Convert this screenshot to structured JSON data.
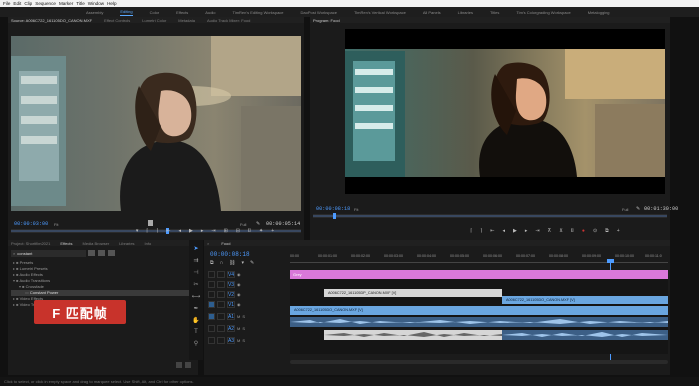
{
  "menu": [
    "File",
    "Edit",
    "Clip",
    "Sequence",
    "Marker",
    "Title",
    "Window",
    "Help"
  ],
  "workspaces": [
    {
      "label": "Assembly",
      "active": false
    },
    {
      "label": "Editing",
      "active": true
    },
    {
      "label": "Color",
      "active": false
    },
    {
      "label": "Effects",
      "active": false
    },
    {
      "label": "Audio",
      "active": false
    },
    {
      "label": "TimRen's Editing Workspace",
      "active": false
    },
    {
      "label": "DaoPost Workspace",
      "active": false
    },
    {
      "label": "TimRen's Vertical Workspace",
      "active": false
    },
    {
      "label": "All Panels",
      "active": false
    },
    {
      "label": "Libraries",
      "active": false
    },
    {
      "label": "Titles",
      "active": false
    },
    {
      "label": "Tim's Colorgrading Workspace",
      "active": false
    },
    {
      "label": "Metalogging",
      "active": false
    }
  ],
  "source": {
    "tabs": [
      "Source: A006C722_161105DO_CANON.MXF",
      "Effect Controls",
      "Lumetri Color",
      "Metadata",
      "Audio Track Mixer: Food"
    ],
    "timecode": "00:00:03:00",
    "fit": "Fit",
    "quality": "Full",
    "duration": "00:00:05:14"
  },
  "program": {
    "tab": "Program: Food",
    "timecode": "00:00:08:18",
    "fit": "Fit",
    "quality": "Full",
    "duration": "00:01:30:00"
  },
  "effects": {
    "tabs": [
      "Project: Shortfilm2021",
      "Effects",
      "Media Browser",
      "Libraries",
      "Info"
    ],
    "search_value": "constant",
    "tree": [
      {
        "label": "Presets",
        "level": 0
      },
      {
        "label": "Lumetri Presets",
        "level": 0
      },
      {
        "label": "Audio Effects",
        "level": 0
      },
      {
        "label": "Audio Transitions",
        "level": 0
      },
      {
        "label": "Crossfade",
        "level": 1
      },
      {
        "label": "Constant Power",
        "level": 2
      },
      {
        "label": "Video Effects",
        "level": 0
      },
      {
        "label": "Video Transitions",
        "level": 0
      }
    ]
  },
  "timeline": {
    "tab": "Food",
    "timecode": "00:00:08:18",
    "ruler": [
      "00:00",
      "00:00:01:00",
      "00:00:02:00",
      "00:00:03:00",
      "00:00:04:00",
      "00:00:05:00",
      "00:00:06:00",
      "00:00:07:00",
      "00:00:08:00",
      "00:00:09:00",
      "00:00:10:00",
      "00:00:11:0"
    ],
    "tracks": [
      "V4",
      "V3",
      "V2",
      "V1",
      "A1",
      "A2",
      "A3"
    ],
    "clips": {
      "adjustment": "Grey",
      "v3a": "A006C722_161105DP_CANON.MXF [V]",
      "v3b": "A006C722_161105DO_CANON.MXF [V]",
      "v2": "A006C722_161105DO_CANON.MXF [V]"
    }
  },
  "overlay_label": "F 匹配帧",
  "status_text": "Click to select, or click in empty space and drag to marquee select. Use Shift, Alt, and Ctrl for other options.",
  "colors": {
    "accent": "#4d9bff",
    "pink_clip": "#d978d9",
    "blue_clip": "#6aa6e0",
    "grey_clip": "#d6d6d6",
    "overlay_red": "#c8332b"
  }
}
